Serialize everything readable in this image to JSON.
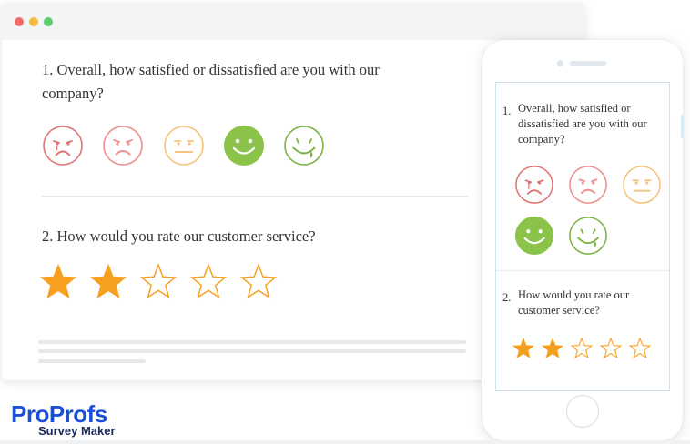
{
  "window": {
    "controls": [
      "close",
      "minimize",
      "maximize"
    ]
  },
  "survey": {
    "q1": {
      "number": "1.",
      "text": "1. Overall, how satisfied or dissatisfied are you with our company?"
    },
    "q2": {
      "number": "2.",
      "text": "2. How would you rate our customer service?"
    },
    "faces": [
      {
        "name": "very-dissatisfied",
        "color": "#e07474"
      },
      {
        "name": "dissatisfied",
        "color": "#ee8f8f"
      },
      {
        "name": "neutral",
        "color": "#f5c27a"
      },
      {
        "name": "satisfied",
        "color": "#8bc34a",
        "filled": true
      },
      {
        "name": "very-satisfied",
        "color": "#7cb342"
      }
    ],
    "rating": {
      "value": 2,
      "max": 5,
      "star_color": "#f7a020"
    }
  },
  "mobile": {
    "q1_number": "1.",
    "q1_text": "Overall, how satisfied or dissatisfied are you with our company?",
    "q2_number": "2.",
    "q2_text": "How would you rate our customer service?"
  },
  "logo": {
    "pro": "Pro",
    "profs": "Profs",
    "sub": "Survey Maker"
  }
}
